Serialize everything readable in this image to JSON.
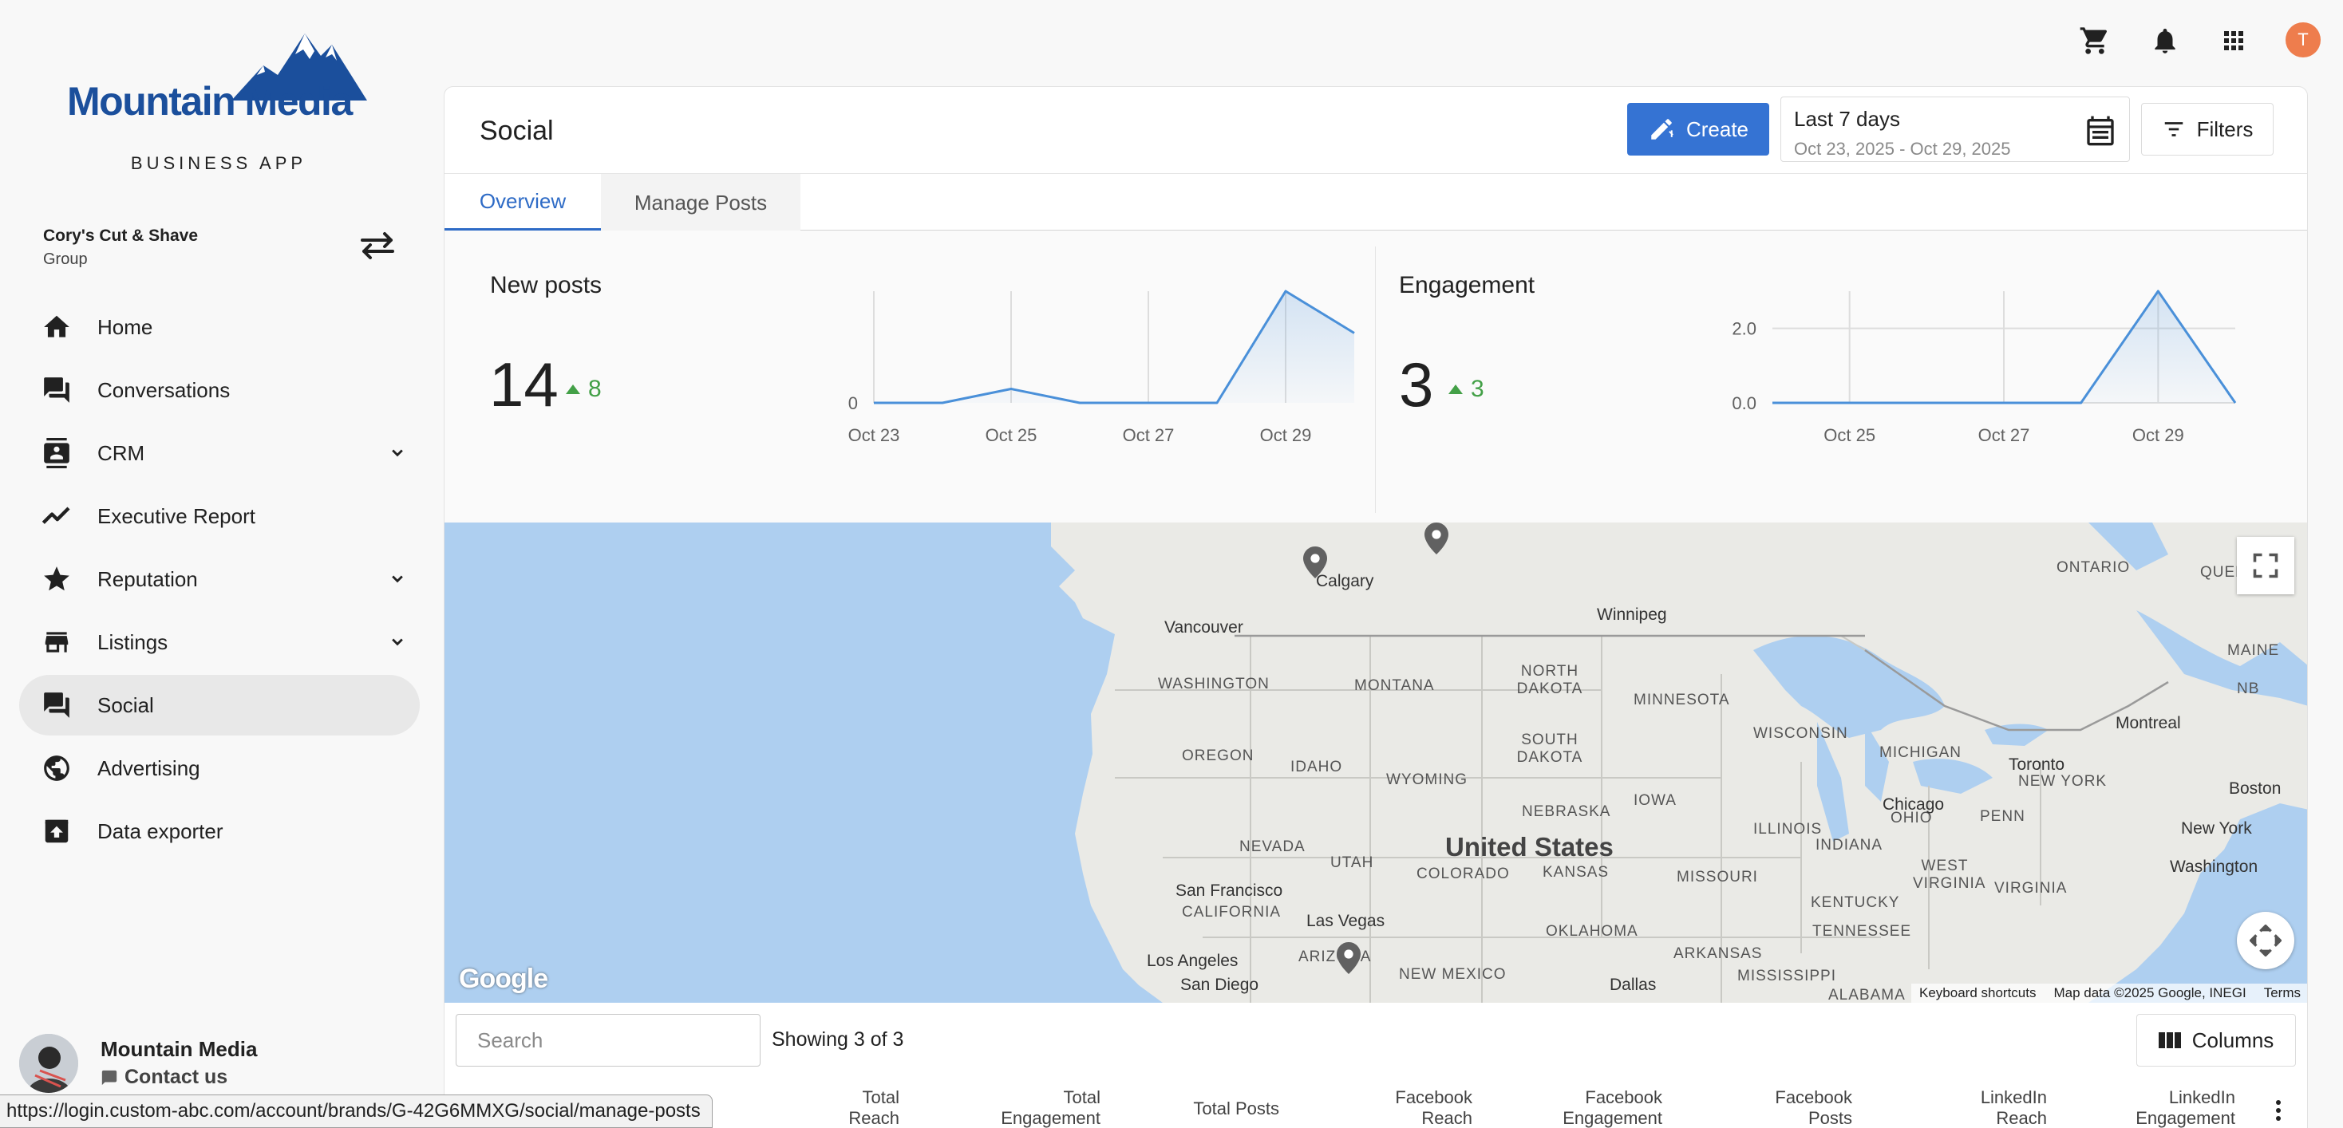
{
  "brand": {
    "name": "Mountain Media",
    "subtitle": "BUSINESS APP"
  },
  "account": {
    "name": "Cory's Cut & Shave",
    "type": "Group"
  },
  "nav": [
    {
      "label": "Home",
      "icon": "home-icon"
    },
    {
      "label": "Conversations",
      "icon": "chat-icon"
    },
    {
      "label": "CRM",
      "icon": "contacts-icon",
      "expandable": true
    },
    {
      "label": "Executive Report",
      "icon": "trend-icon"
    },
    {
      "label": "Reputation",
      "icon": "star-icon",
      "expandable": true
    },
    {
      "label": "Listings",
      "icon": "store-icon",
      "expandable": true
    },
    {
      "label": "Social",
      "icon": "chat-icon",
      "active": true
    },
    {
      "label": "Advertising",
      "icon": "globe-icon"
    },
    {
      "label": "Data exporter",
      "icon": "export-icon"
    }
  ],
  "user": {
    "name": "Mountain Media",
    "contact_label": "Contact us"
  },
  "status_url": "https://login.custom-abc.com/account/brands/G-42G6MMXG/social/manage-posts",
  "topbar": {
    "avatar_initial": "T",
    "avatar_color": "#ee7d4d"
  },
  "page": {
    "title": "Social",
    "create_label": "Create",
    "date": {
      "label": "Last 7 days",
      "range": "Oct 23, 2025 - Oct 29, 2025"
    },
    "filters_label": "Filters",
    "tabs": [
      {
        "label": "Overview",
        "active": true
      },
      {
        "label": "Manage Posts",
        "active": false
      }
    ]
  },
  "stats": {
    "new_posts": {
      "title": "New posts",
      "value": "14",
      "delta": "8"
    },
    "engagement": {
      "title": "Engagement",
      "value": "3",
      "delta": "3"
    }
  },
  "chart_data": [
    {
      "type": "area",
      "title": "New posts",
      "x": [
        "Oct 23",
        "Oct 24",
        "Oct 25",
        "Oct 26",
        "Oct 27",
        "Oct 28",
        "Oct 29",
        "Oct 30"
      ],
      "x_tick_labels": [
        "Oct 23",
        "Oct 25",
        "Oct 27",
        "Oct 29"
      ],
      "y_tick_labels": [
        "0"
      ],
      "series": [
        {
          "values": [
            0,
            0,
            1,
            0,
            0,
            0,
            8,
            5
          ]
        }
      ],
      "ylim": [
        0,
        8
      ],
      "grid": "vertical",
      "color": "#4a90d9"
    },
    {
      "type": "area",
      "title": "Engagement",
      "x": [
        "Oct 24",
        "Oct 25",
        "Oct 26",
        "Oct 27",
        "Oct 28",
        "Oct 29",
        "Oct 30"
      ],
      "x_tick_labels": [
        "Oct 25",
        "Oct 27",
        "Oct 29"
      ],
      "y_tick_labels": [
        "2.0",
        "0.0"
      ],
      "series": [
        {
          "values": [
            0,
            0,
            0,
            0,
            0,
            3,
            0
          ]
        }
      ],
      "ylim": [
        0,
        3
      ],
      "grid": "both",
      "color": "#4a90d9"
    }
  ],
  "map": {
    "regions": [
      "ONTARIO",
      "QUEBEC",
      "WASHINGTON",
      "MONTANA",
      "NORTH DAKOTA",
      "MINNESOTA",
      "WISCONSIN",
      "MICHIGAN",
      "OREGON",
      "IDAHO",
      "WYOMING",
      "SOUTH DAKOTA",
      "NEBRASKA",
      "IOWA",
      "NEVADA",
      "UTAH",
      "COLORADO",
      "KANSAS",
      "MISSOURI",
      "ILLINOIS",
      "INDIANA",
      "OHIO",
      "PENN",
      "NEW YORK",
      "NB",
      "CALIFORNIA",
      "ARIZONA",
      "NEW MEXICO",
      "OKLAHOMA",
      "ARKANSAS",
      "TENNESSEE",
      "KENTUCKY",
      "WEST VIRGINIA",
      "MISSISSIPPI",
      "ALABAMA",
      "MAINE",
      "VIRGINIA"
    ],
    "cities": [
      "Calgary",
      "Vancouver",
      "Winnipeg",
      "Chicago",
      "Toronto",
      "Montreal",
      "Boston",
      "New York",
      "Washington",
      "San Francisco",
      "Las Vegas",
      "Los Angeles",
      "San Diego",
      "Dallas"
    ],
    "country": "United States",
    "attribution": {
      "keyboard": "Keyboard shortcuts",
      "data": "Map data ©2025 Google, INEGI",
      "terms": "Terms"
    },
    "logo": "Google"
  },
  "table": {
    "search_placeholder": "Search",
    "showing": "Showing 3 of 3",
    "columns_label": "Columns",
    "headers": [
      [
        "Total",
        "Reach"
      ],
      [
        "Total",
        "Engagement"
      ],
      [
        "Total Posts"
      ],
      [
        "Facebook",
        "Reach"
      ],
      [
        "Facebook",
        "Engagement"
      ],
      [
        "Facebook",
        "Posts"
      ],
      [
        "LinkedIn",
        "Reach"
      ],
      [
        "LinkedIn",
        "Engagement"
      ]
    ]
  }
}
